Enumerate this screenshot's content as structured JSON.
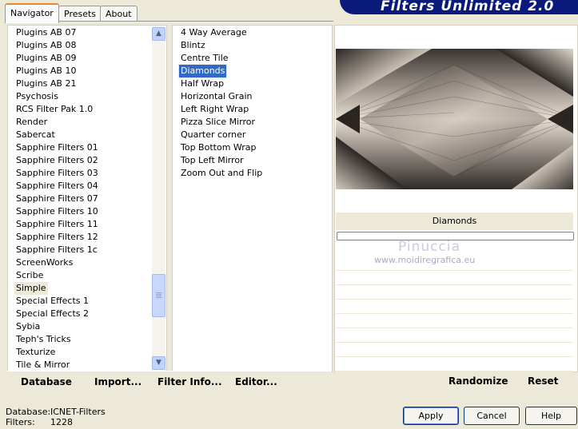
{
  "tabs": [
    "Navigator",
    "Presets",
    "About"
  ],
  "banner_title": "Filters Unlimited 2.0",
  "categories": [
    "Plugins AB 07",
    "Plugins AB 08",
    "Plugins AB 09",
    "Plugins AB 10",
    "Plugins AB 21",
    "Psychosis",
    "RCS Filter Pak 1.0",
    "Render",
    "Sabercat",
    "Sapphire Filters 01",
    "Sapphire Filters 02",
    "Sapphire Filters 03",
    "Sapphire Filters 04",
    "Sapphire Filters 07",
    "Sapphire Filters 10",
    "Sapphire Filters 11",
    "Sapphire Filters 12",
    "Sapphire Filters 1c",
    "ScreenWorks",
    "Scribe",
    "Simple",
    "Special Effects 1",
    "Special Effects 2",
    "Sybia",
    "Teph's Tricks",
    "Texturize",
    "Tile & Mirror"
  ],
  "highlighted_category": "Simple",
  "filters": [
    "4 Way Average",
    "Blintz",
    "Centre Tile",
    "Diamonds",
    "Half Wrap",
    "Horizontal Grain",
    "Left Right Wrap",
    "Pizza Slice Mirror",
    "Quarter corner",
    "Top Bottom Wrap",
    "Top Left Mirror",
    "Zoom Out and Flip"
  ],
  "selected_filter": "Diamonds",
  "toolbar": {
    "database": "Database",
    "import": "Import...",
    "filter_info": "Filter Info...",
    "editor": "Editor...",
    "randomize": "Randomize",
    "reset": "Reset"
  },
  "filter_name_label": "Diamonds",
  "watermark": {
    "name": "Pinuccia",
    "url": "www.moidiregrafica.eu"
  },
  "status": {
    "database_label": "Database:",
    "database_value": "ICNET-Filters",
    "filters_label": "Filters:",
    "filters_value": "1228"
  },
  "buttons": {
    "apply": "Apply",
    "cancel": "Cancel",
    "help": "Help"
  },
  "icons": {
    "scroll_up": "chevron-up-icon",
    "scroll_down": "chevron-down-icon"
  },
  "colors": {
    "selection": "#316ac5",
    "banner": "#0a1a7a",
    "tab_accent": "#e68b2c"
  }
}
